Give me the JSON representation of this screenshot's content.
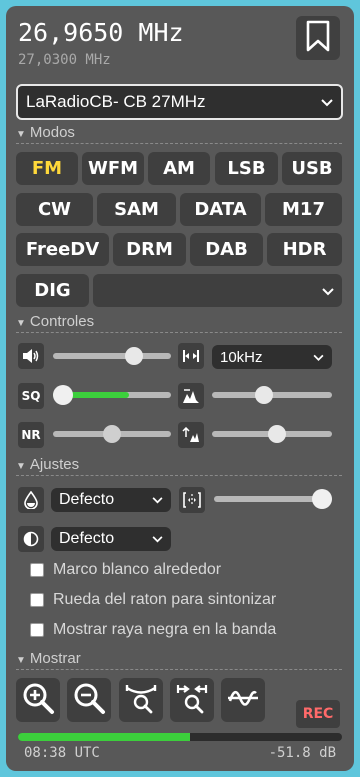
{
  "header": {
    "frequency": "26,9650 MHz",
    "sub_frequency": "27,0300 MHz",
    "bookmark_icon": "bookmark-icon"
  },
  "station_select": {
    "value": "LaRadioCB- CB 27MHz"
  },
  "modes": {
    "title": "Modos",
    "buttons": [
      "FM",
      "WFM",
      "AM",
      "LSB",
      "USB",
      "CW",
      "SAM",
      "DATA",
      "M17",
      "FreeDV",
      "DRM",
      "DAB",
      "HDR",
      "DIG"
    ],
    "active": "FM",
    "active_color": "#ffd83a",
    "extra_select_value": ""
  },
  "controls": {
    "title": "Controles",
    "volume_icon": "volume-icon",
    "volume_level": 0.72,
    "bandwidth_icon": "bandwidth-icon",
    "bandwidth_value": "10kHz",
    "squelch_label": "SQ",
    "squelch_level": 0.0,
    "squelch_fill_fraction": 0.64,
    "squelch_fill_color": "#3ccf3c",
    "waterfall_min_icon": "waterfall-min-icon",
    "waterfall_min_level": 0.42,
    "nr_label": "NR",
    "nr_level": 0.5,
    "waterfall_max_icon": "waterfall-max-icon",
    "waterfall_max_level": 0.55
  },
  "settings": {
    "title": "Ajustes",
    "colormap_icon": "droplet-icon",
    "colormap_value": "Defecto",
    "zoom_icon": "waterfall-zoom-icon",
    "zoom_level": 1.0,
    "contrast_icon": "contrast-icon",
    "theme_value": "Defecto",
    "checks": [
      "Marco blanco alrededor",
      "Rueda del raton para sintonizar",
      "Mostrar raya negra en la banda"
    ]
  },
  "display": {
    "title": "Mostrar",
    "tools": [
      "zoom-in-icon",
      "zoom-out-icon",
      "zoom-band-icon",
      "zoom-fit-icon",
      "spectrum-icon"
    ],
    "rec_label": "REC",
    "rec_color": "#ff6a6a",
    "signal_level": 0.53,
    "time": "08:38 UTC",
    "signal_db": "-51.8 dB"
  }
}
